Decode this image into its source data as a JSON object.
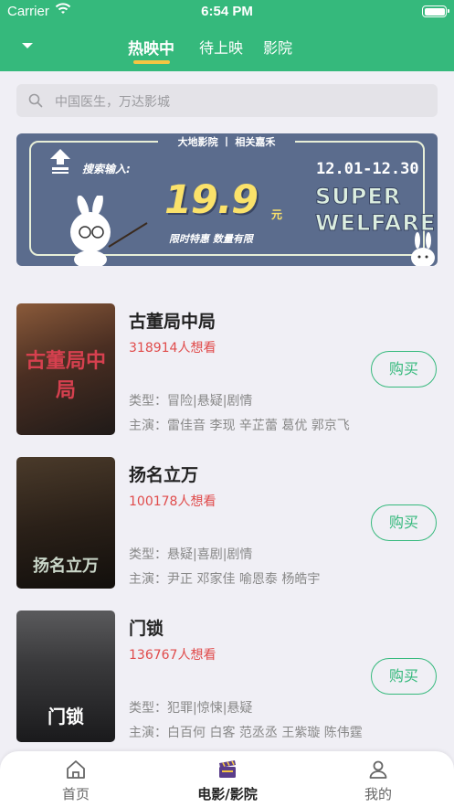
{
  "status_bar": {
    "carrier": "Carrier",
    "time": "6:54 PM"
  },
  "nav": {
    "tabs": [
      {
        "label": "热映中",
        "active": true
      },
      {
        "label": "待上映",
        "active": false
      },
      {
        "label": "影院",
        "active": false
      }
    ]
  },
  "search": {
    "placeholder": "中国医生，万达影城"
  },
  "banner": {
    "top_text": "大地影院 丨 相关嘉禾",
    "search_label": "搜索输入:",
    "price": "19.9",
    "unit": "元",
    "limit_text": "限时特惠  数量有限",
    "date_range": "12.01-12.30",
    "super_text": "SUPER",
    "welfare_text": "WELFARE"
  },
  "movies": [
    {
      "title": "古董局中局",
      "wants": "318914人想看",
      "genre": "类型：冒险|悬疑|剧情",
      "cast": "主演：雷佳音 李现 辛芷蕾 葛优 郭京飞",
      "buy_label": "购买",
      "poster_text": "古董局中局",
      "poster_colors": [
        "#6b3a2a",
        "#2a2420"
      ]
    },
    {
      "title": "扬名立万",
      "wants": "100178人想看",
      "genre": "类型：悬疑|喜剧|剧情",
      "cast": "主演：尹正 邓家佳 喻恩泰 杨皓宇",
      "buy_label": "购买",
      "poster_text": "扬名立万",
      "poster_colors": [
        "#3a2e22",
        "#191510"
      ]
    },
    {
      "title": "门锁",
      "wants": "136767人想看",
      "genre": "类型：犯罪|惊悚|悬疑",
      "cast": "主演：白百何 白客 范丞丞 王紫璇 陈伟霆",
      "buy_label": "购买",
      "poster_text": "门锁",
      "poster_colors": [
        "#4a4a4c",
        "#1a1a1c"
      ]
    }
  ],
  "tab_bar": {
    "items": [
      {
        "label": "首页",
        "icon": "home-icon",
        "active": false
      },
      {
        "label": "电影/影院",
        "icon": "clapperboard-icon",
        "active": true
      },
      {
        "label": "我的",
        "icon": "profile-icon",
        "active": false
      }
    ]
  },
  "colors": {
    "brand_green": "#35b97c",
    "accent_yellow": "#f5c542",
    "wants_red": "#e04b4b"
  }
}
